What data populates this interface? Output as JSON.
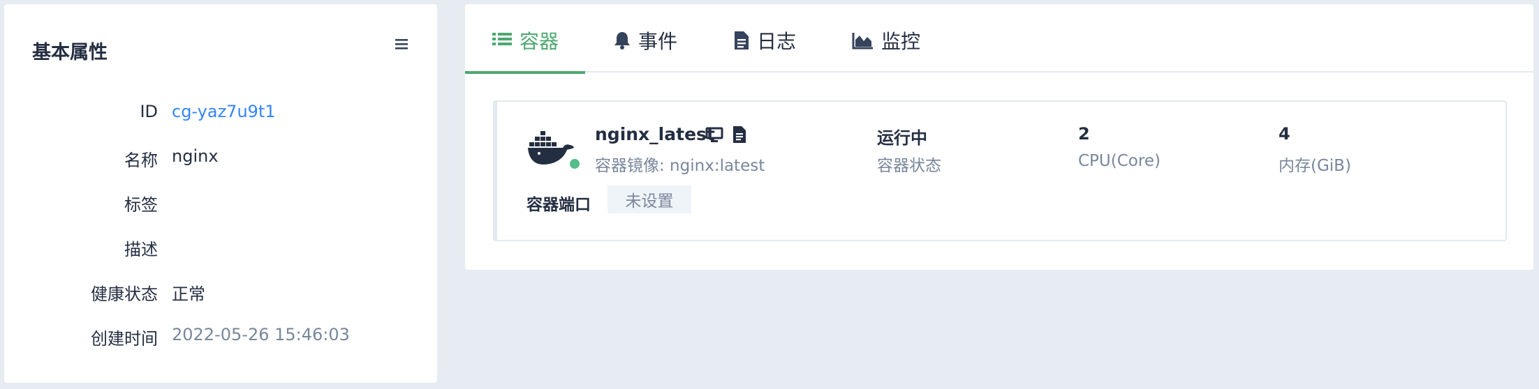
{
  "basic": {
    "title": "基本属性",
    "menu_icon": "list-menu-icon",
    "props": [
      {
        "label": "ID",
        "value": "cg-yaz7u9t1"
      },
      {
        "label": "名称",
        "value": "nginx"
      },
      {
        "label": "标签",
        "value": ""
      },
      {
        "label": "描述",
        "value": ""
      },
      {
        "label": "健康状态",
        "value": "正常"
      },
      {
        "label": "创建时间",
        "value": "2022-05-26 15:46:03"
      }
    ]
  },
  "tabs": [
    {
      "label": "容器",
      "icon": "list-icon",
      "active": true
    },
    {
      "label": "事件",
      "icon": "bell-icon",
      "active": false
    },
    {
      "label": "日志",
      "icon": "file-icon",
      "active": false
    },
    {
      "label": "监控",
      "icon": "area-chart-icon",
      "active": false
    }
  ],
  "container": {
    "name": "nginx_latest",
    "image_text": "容器镜像: nginx:latest",
    "status_value": "运行中",
    "status_label": "容器状态",
    "cpu_value": "2",
    "cpu_label": "CPU(Core)",
    "mem_value": "4",
    "mem_label": "内存(GiB)",
    "ports_label": "容器端口",
    "ports_value": "未设置"
  },
  "colors": {
    "accent": "#4ca86f",
    "running": "#55bc8a",
    "link": "#3385ff",
    "muted": "#79879c"
  }
}
